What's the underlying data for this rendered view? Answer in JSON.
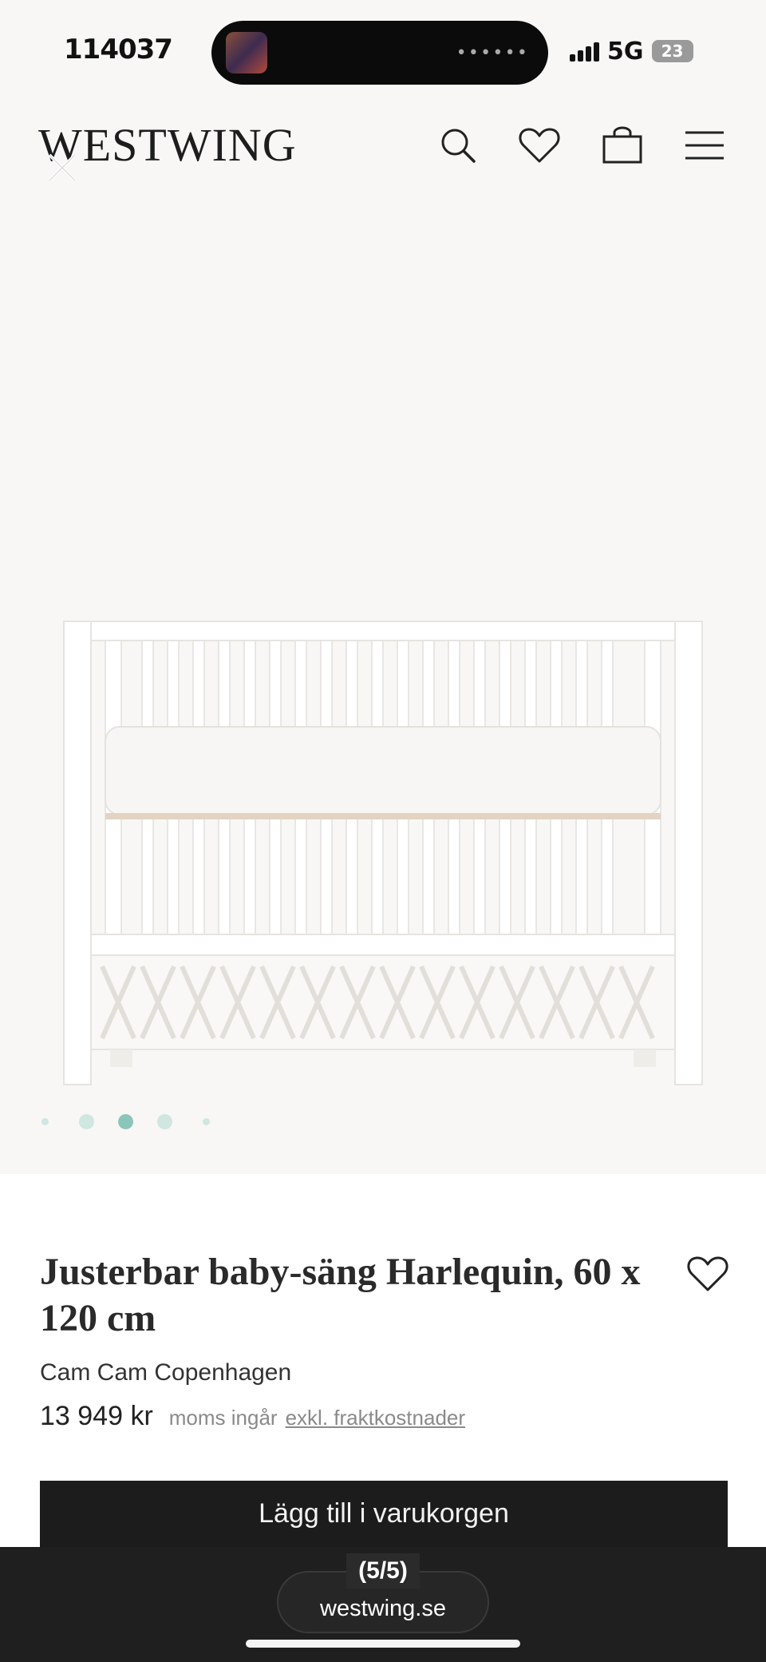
{
  "status_bar": {
    "time": "114037",
    "network": "5G",
    "battery": "23"
  },
  "header": {
    "logo": "WESTWING",
    "icons": [
      "search-icon",
      "heart-icon",
      "bag-icon",
      "menu-icon"
    ]
  },
  "gallery": {
    "image_alt": "crib",
    "active_dot": 2,
    "dot_count": 5
  },
  "product": {
    "title": "Justerbar baby-säng Harlequin, 60 x 120 cm",
    "brand": "Cam Cam Copenhagen",
    "price": "13 949 kr",
    "vat_note": "moms ingår",
    "shipping_link": "exkl. fraktkostnader",
    "cart_button": "Lägg till i varukorgen"
  },
  "browser": {
    "page_counter": "(5/5)",
    "url": "westwing.se"
  },
  "colors": {
    "background": "#f8f7f5",
    "button": "#1c1c1c",
    "dot_active": "#8cc5b9",
    "dot_inactive": "#cfe6e1"
  }
}
